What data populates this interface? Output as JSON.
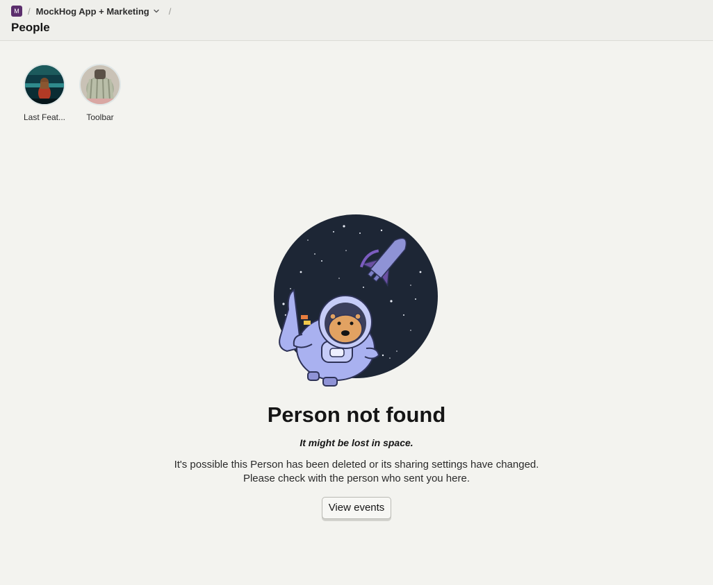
{
  "breadcrumb": {
    "project_badge": "M",
    "separator": "/",
    "project_name": "MockHog App + Marketing"
  },
  "page_title": "People",
  "shortcuts": [
    {
      "label": "Last Feat...",
      "icon": "avatar-lake-person"
    },
    {
      "label": "Toolbar",
      "icon": "avatar-blanket"
    }
  ],
  "error": {
    "illustration": "astronaut-hedgehog-space-illustration",
    "title": "Person not found",
    "subtitle": "It might be lost in space.",
    "description_line1": "It's possible this Person has been deleted or its sharing settings have changed.",
    "description_line2": "Please check with the person who sent you here.",
    "button_label": "View events"
  },
  "colors": {
    "background": "#f3f3ef",
    "project_badge": "#5b2e6c",
    "space_circle": "#1d2635",
    "suit": "#a9b1f0"
  }
}
